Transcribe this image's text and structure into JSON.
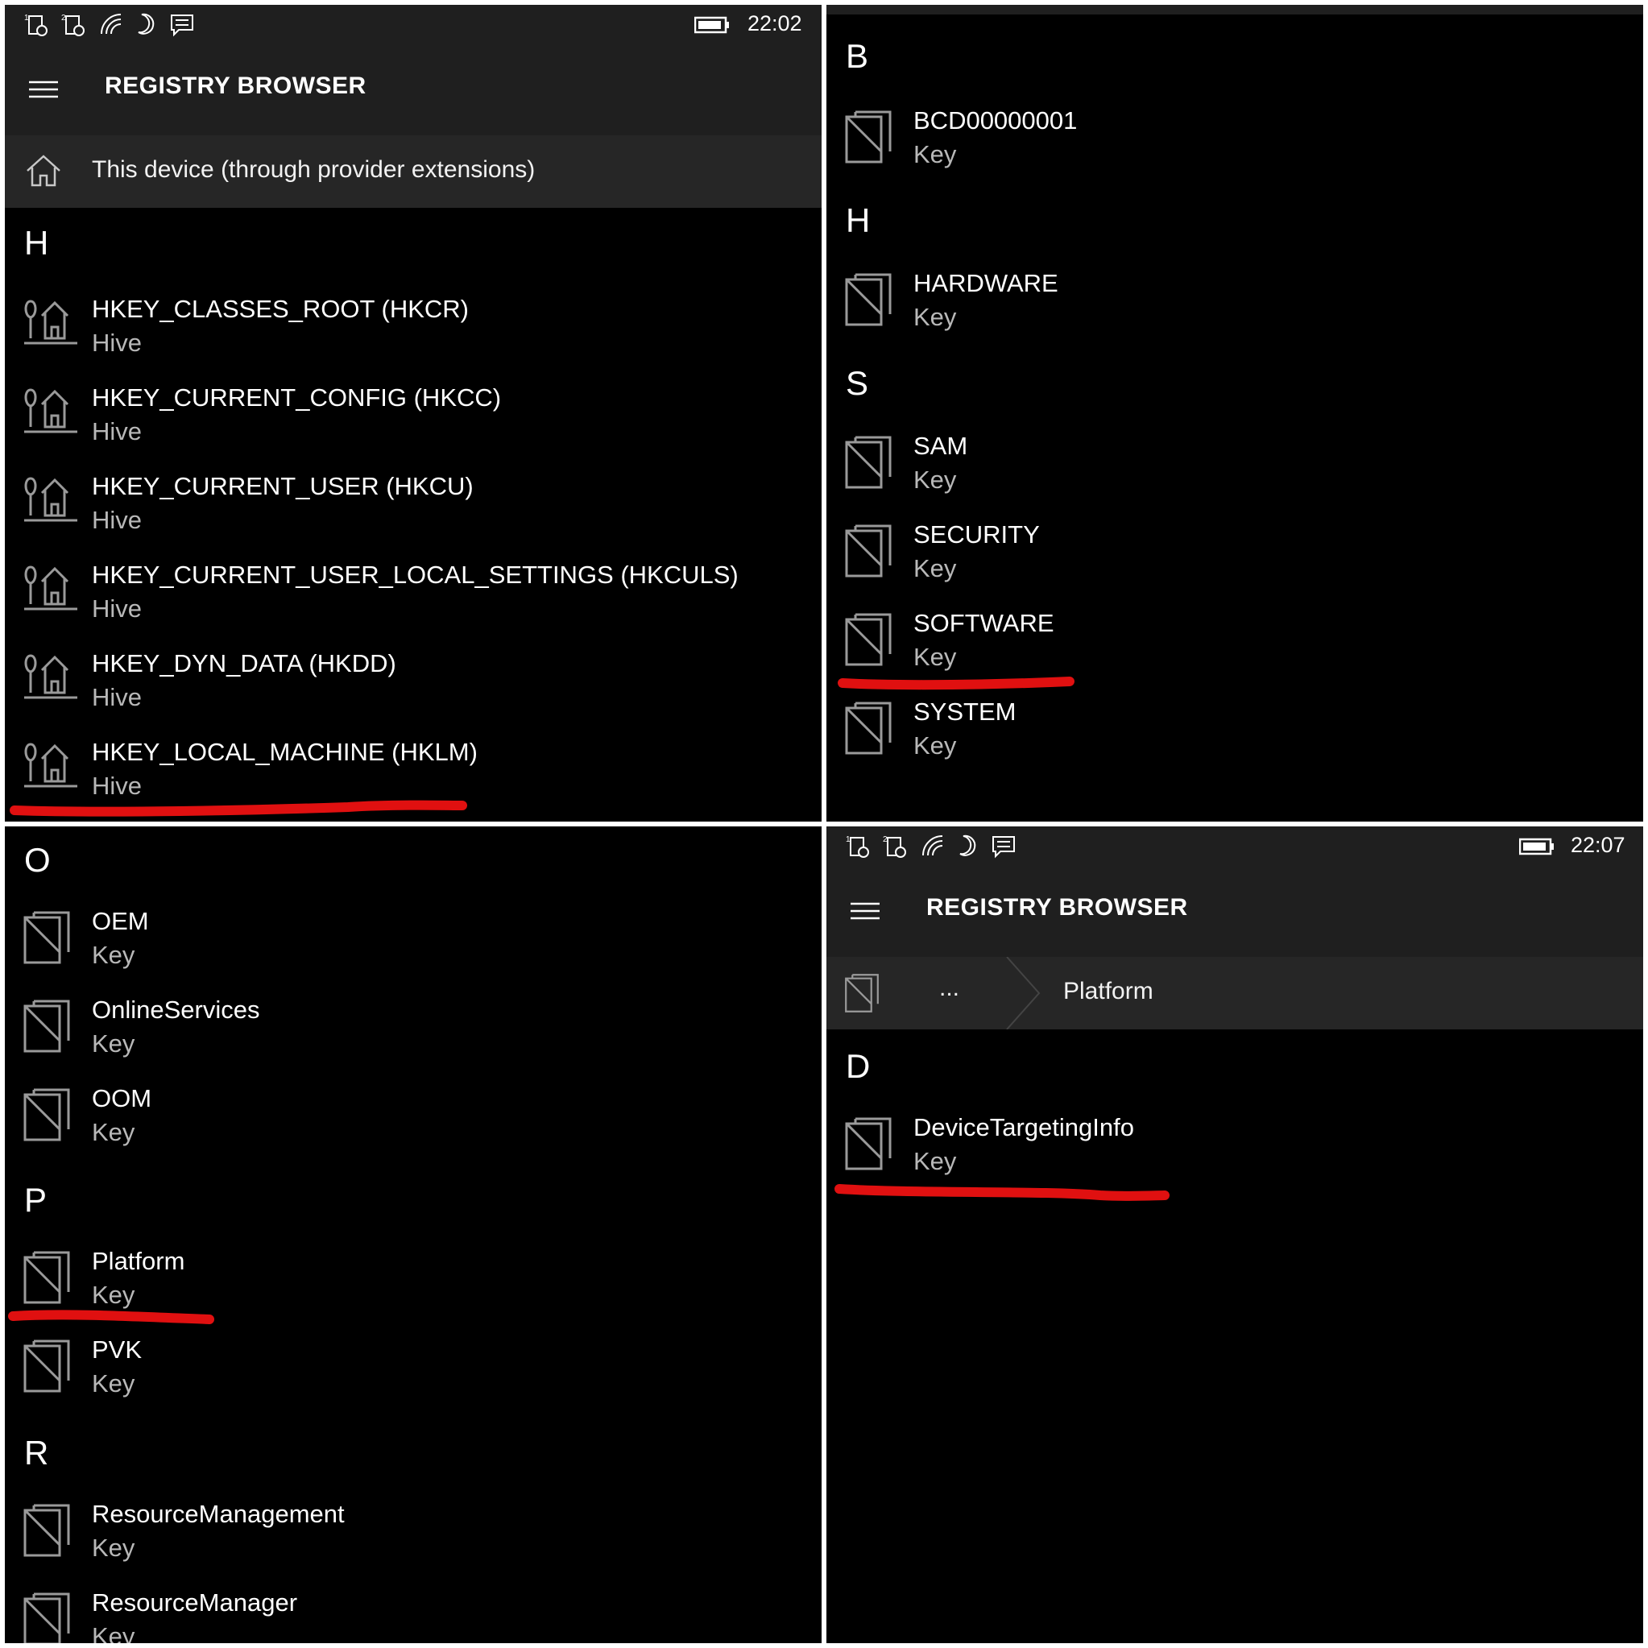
{
  "status_bar": {
    "time_1": "22:02",
    "time_2": "22:07"
  },
  "app": {
    "title": "REGISTRY BROWSER"
  },
  "location": {
    "root_label": "This device (through provider extensions)"
  },
  "breadcrumb": {
    "ellipsis": "...",
    "current": "Platform"
  },
  "panel1": {
    "group": "H",
    "items": [
      {
        "name": "HKEY_CLASSES_ROOT (HKCR)",
        "type": "Hive"
      },
      {
        "name": "HKEY_CURRENT_CONFIG (HKCC)",
        "type": "Hive"
      },
      {
        "name": "HKEY_CURRENT_USER (HKCU)",
        "type": "Hive"
      },
      {
        "name": "HKEY_CURRENT_USER_LOCAL_SETTINGS (HKCULS)",
        "type": "Hive"
      },
      {
        "name": "HKEY_DYN_DATA (HKDD)",
        "type": "Hive"
      },
      {
        "name": "HKEY_LOCAL_MACHINE (HKLM)",
        "type": "Hive"
      }
    ]
  },
  "panel2": {
    "groups": [
      {
        "letter": "B",
        "items": [
          {
            "name": "BCD00000001",
            "type": "Key"
          }
        ]
      },
      {
        "letter": "H",
        "items": [
          {
            "name": "HARDWARE",
            "type": "Key"
          }
        ]
      },
      {
        "letter": "S",
        "items": [
          {
            "name": "SAM",
            "type": "Key"
          },
          {
            "name": "SECURITY",
            "type": "Key"
          },
          {
            "name": "SOFTWARE",
            "type": "Key"
          },
          {
            "name": "SYSTEM",
            "type": "Key"
          }
        ]
      }
    ]
  },
  "panel3": {
    "groups": [
      {
        "letter": "O",
        "items": [
          {
            "name": "OEM",
            "type": "Key"
          },
          {
            "name": "OnlineServices",
            "type": "Key"
          },
          {
            "name": "OOM",
            "type": "Key"
          }
        ]
      },
      {
        "letter": "P",
        "items": [
          {
            "name": "Platform",
            "type": "Key"
          },
          {
            "name": "PVK",
            "type": "Key"
          }
        ]
      },
      {
        "letter": "R",
        "items": [
          {
            "name": "ResourceManagement",
            "type": "Key"
          },
          {
            "name": "ResourceManager",
            "type": "Key"
          }
        ]
      }
    ]
  },
  "panel4": {
    "group": "D",
    "items": [
      {
        "name": "DeviceTargetingInfo",
        "type": "Key"
      }
    ]
  },
  "icons": {
    "hive": "hive-icon",
    "key": "registry-key-icon",
    "home": "home-icon",
    "menu": "hamburger-icon",
    "battery": "battery-icon"
  },
  "colors": {
    "background": "#000000",
    "chrome": "#1f1f1f",
    "annotation": "#e01010"
  }
}
